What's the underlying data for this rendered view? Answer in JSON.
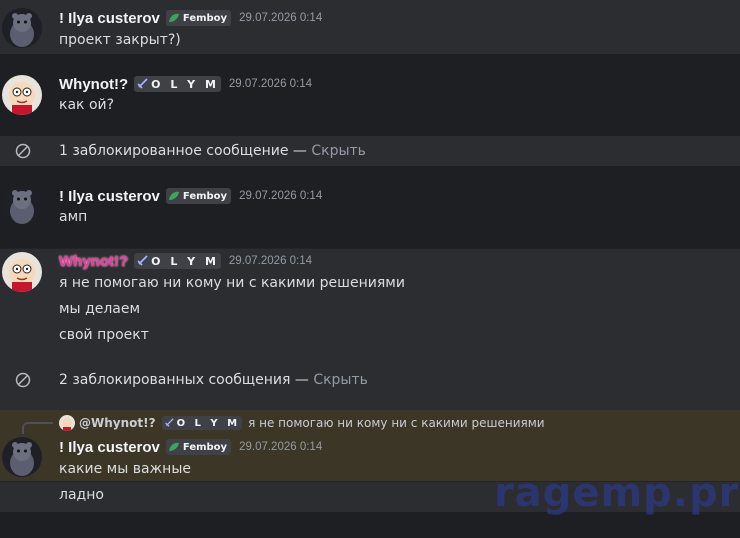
{
  "messages": [
    {
      "username": "! Ilya custerov",
      "tag": "Femboy",
      "timestamp": "29.07.2026 0:14",
      "lines": [
        "проект закрыт?)"
      ]
    },
    {
      "username": "Whynot!?",
      "tag": "O L Y M",
      "timestamp": "29.07.2026 0:14",
      "lines": [
        "как ой?"
      ]
    },
    {
      "username": "! Ilya custerov",
      "tag": "Femboy",
      "timestamp": "29.07.2026 0:14",
      "lines": [
        "амп"
      ]
    },
    {
      "username": "Whynot!?",
      "tag": "O L Y M",
      "timestamp": "29.07.2026 0:14",
      "lines": [
        "я не помогаю ни кому  ни с какими решениями",
        "мы делаем",
        "свой проект"
      ]
    },
    {
      "username": "! Ilya custerov",
      "tag": "Femboy",
      "timestamp": "29.07.2026 0:14",
      "lines": [
        "какие мы важные",
        "ладно"
      ]
    }
  ],
  "blocked": [
    {
      "text": "1 заблокированное сообщение",
      "sep": " — ",
      "action": "Скрыть"
    },
    {
      "text": "2 заблокированных сообщения",
      "sep": " — ",
      "action": "Скрыть"
    }
  ],
  "reply": {
    "mention": "@Whynot!?",
    "tag": "O L Y M",
    "text": "я не помогаю ни кому  ни с какими решениями"
  },
  "watermark": "ragemp.pro",
  "colors": {
    "background": "#2b2d31",
    "highlight_row": "#1e1f22",
    "mention_row": "#3b3626",
    "pink_name": "#ff2fa0",
    "leaf_green": "#3ba55d"
  }
}
